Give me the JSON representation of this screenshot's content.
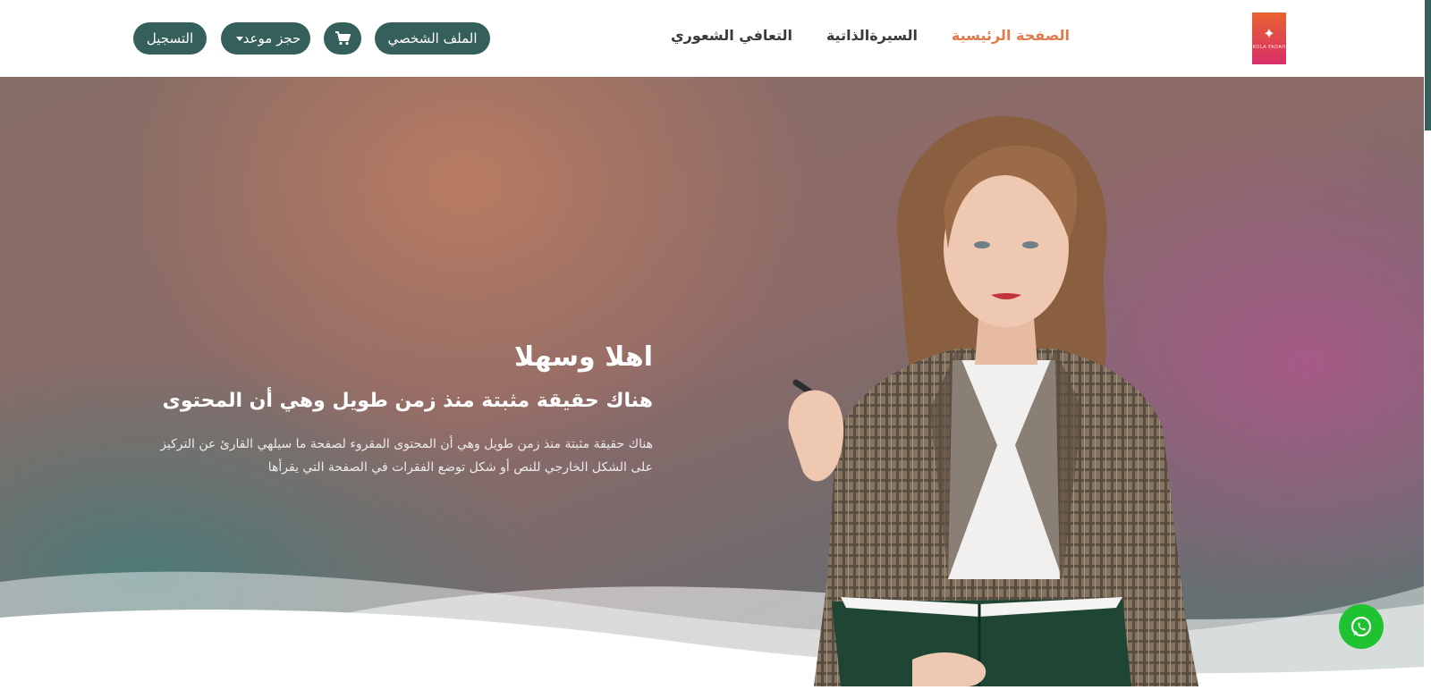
{
  "header": {
    "logo_alt": "logo",
    "logo_text": "ROLA FADAH",
    "nav": [
      {
        "label": "الصفحة الرئيسية",
        "active": true
      },
      {
        "label": "السيرةالذاتية",
        "active": false
      },
      {
        "label": "التعافي الشعوري",
        "active": false
      }
    ],
    "profile_button": "الملف الشخصي",
    "booking_button": "حجز موعد",
    "register_button": "التسجيل",
    "cart_icon": "cart-icon"
  },
  "hero": {
    "welcome": "اهلا وسهلا",
    "subtitle": "هناك حقيقة مثبتة منذ زمن طويل وهي أن المحتوى",
    "body": "هناك حقيقة مثبتة منذ زمن طويل وهي أن المحتوى المقروء لصفحة ما سيلهي القارئ عن التركيز على الشكل الخارجي للنص أو شكل توضع الفقرات في الصفحة التي يقرأها"
  },
  "colors": {
    "accent": "#e07a4c",
    "button": "#355f5b",
    "whatsapp": "#1fc230"
  },
  "whatsapp_icon": "whatsapp-icon"
}
